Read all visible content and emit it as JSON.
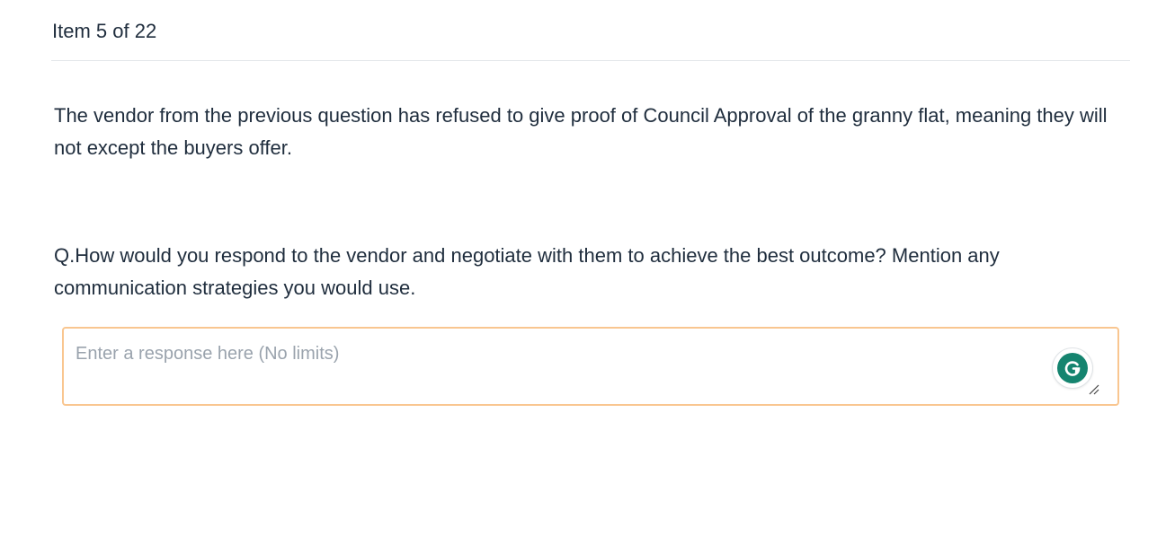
{
  "header": {
    "item_counter": "Item 5 of 22"
  },
  "prompt": {
    "text": "The vendor from the previous question has refused to give proof of Council Approval of the granny flat, meaning they will not except the buyers offer."
  },
  "question": {
    "text": "Q.How would you respond to the vendor and negotiate with them to achieve the best outcome? Mention any communication strategies you would use."
  },
  "response": {
    "value": "",
    "placeholder": "Enter a response here (No limits)"
  },
  "icons": {
    "grammarly": "grammarly-g-icon",
    "resize": "resize-handle-icon"
  },
  "colors": {
    "text": "#1f2d3d",
    "input_border": "#f9c690",
    "grammarly_green": "#15846f",
    "placeholder": "#9aa3ad"
  }
}
